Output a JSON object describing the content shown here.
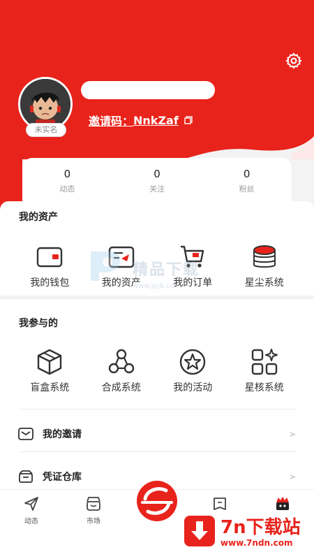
{
  "colors": {
    "brand": "#e8231b",
    "background": "#f3f3f3"
  },
  "profile": {
    "realname_badge": "未实名",
    "invite_label": "邀请码：",
    "invite_code": "NnkZaf"
  },
  "stats": [
    {
      "value": "0",
      "label": "动态"
    },
    {
      "value": "0",
      "label": "关注"
    },
    {
      "value": "0",
      "label": "粉丝"
    }
  ],
  "assets": {
    "title": "我的资产",
    "items": [
      {
        "label": "我的钱包",
        "icon": "wallet-icon"
      },
      {
        "label": "我的资产",
        "icon": "asset-icon"
      },
      {
        "label": "我的订单",
        "icon": "cart-icon"
      },
      {
        "label": "星尘系统",
        "icon": "coins-stack-icon"
      }
    ]
  },
  "participation": {
    "title": "我参与的",
    "items": [
      {
        "label": "盲盒系统",
        "icon": "box-icon"
      },
      {
        "label": "合成系统",
        "icon": "synthesis-icon"
      },
      {
        "label": "我的活动",
        "icon": "star-circle-icon"
      },
      {
        "label": "星核系统",
        "icon": "grid-sparkle-icon"
      }
    ]
  },
  "rows": [
    {
      "label": "我的邀请",
      "arrow": ">",
      "icon": "mail-icon"
    },
    {
      "label": "凭证仓库",
      "arrow": ">",
      "icon": "warehouse-icon"
    }
  ],
  "nav": [
    {
      "label": "动态",
      "icon": "send-icon"
    },
    {
      "label": "市场",
      "icon": "store-icon"
    },
    {
      "label": "",
      "icon": "home-logo-icon"
    },
    {
      "label": "",
      "icon": "card-icon"
    },
    {
      "label": "",
      "icon": "profile-icon"
    }
  ],
  "watermark": {
    "text": "精品下载",
    "url": "www.jpjb.com"
  },
  "corner_brand": {
    "name": "7n下载站",
    "url": "www.7ndn.com"
  }
}
